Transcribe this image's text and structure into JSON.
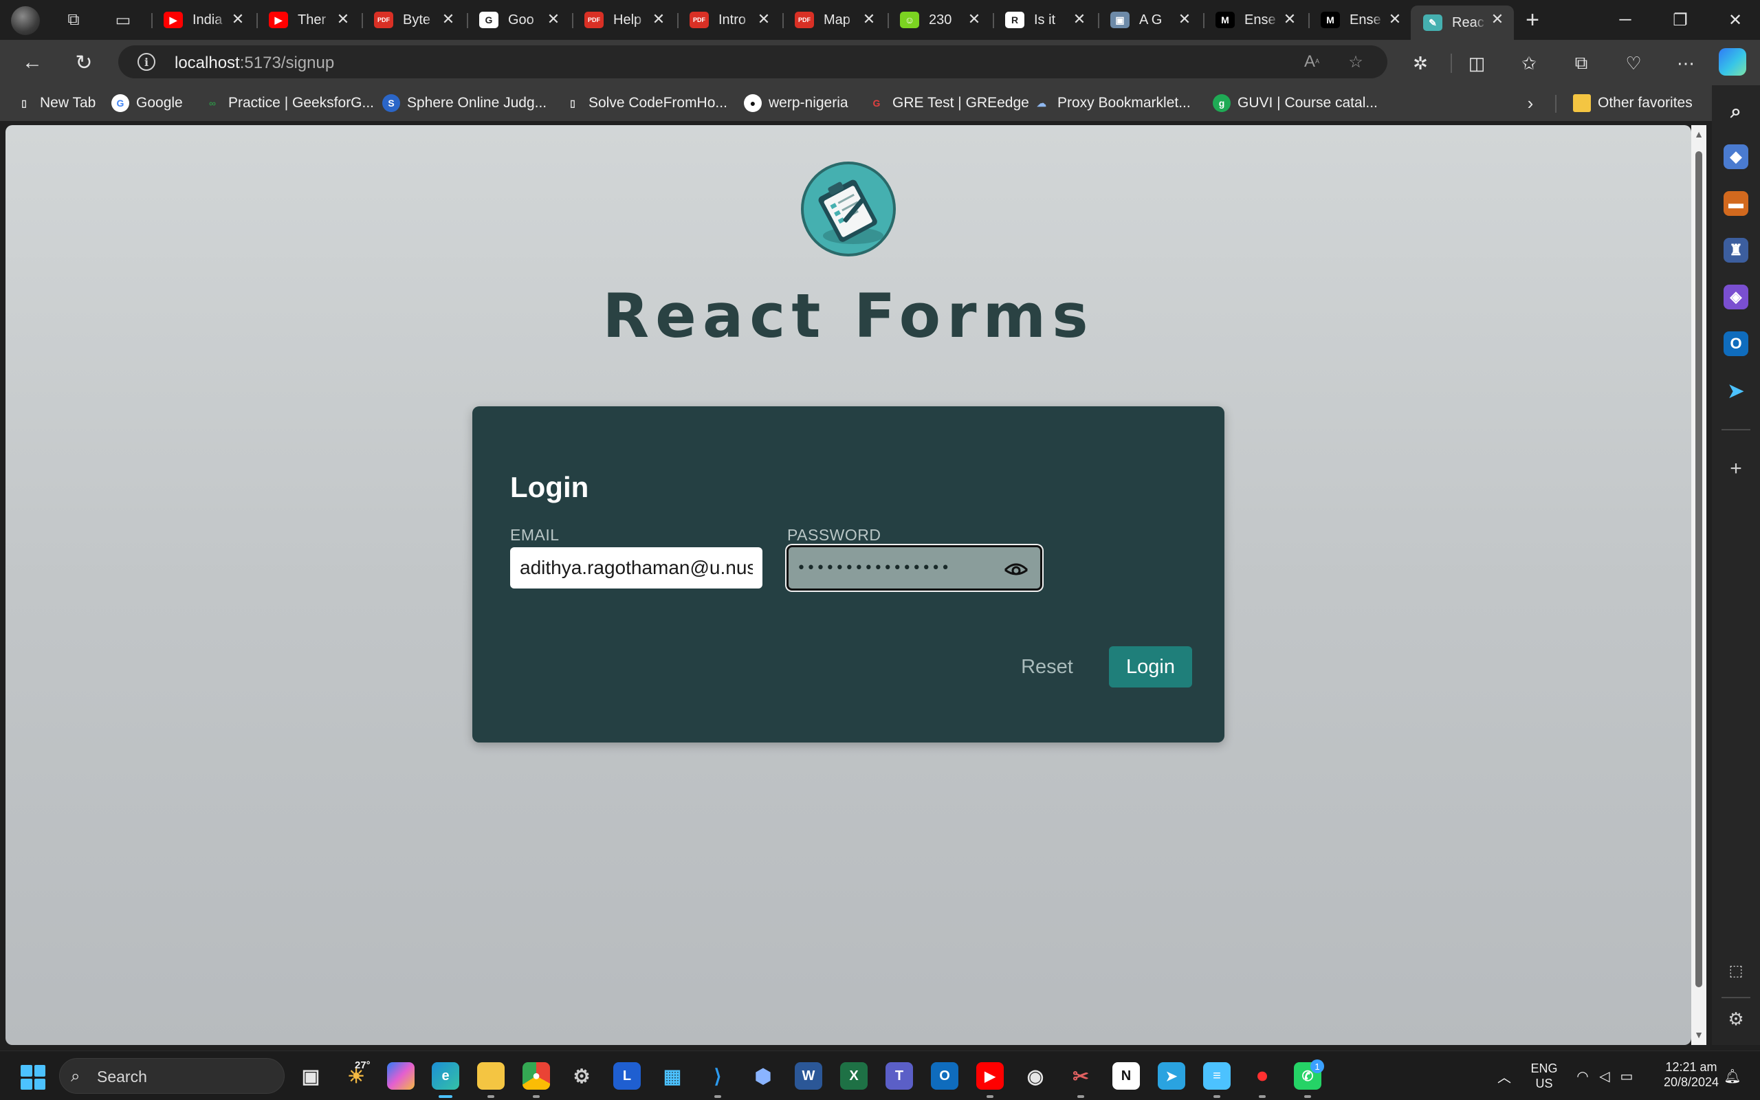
{
  "browser": {
    "tabs": [
      {
        "title": "India",
        "icon": "youtube-icon",
        "color": "#ff0000",
        "glyph": "▶"
      },
      {
        "title": "Ther",
        "icon": "youtube-icon",
        "color": "#ff0000",
        "glyph": "▶"
      },
      {
        "title": "Byte",
        "icon": "pdf-icon",
        "color": "#d93025",
        "glyph": "PDF"
      },
      {
        "title": "Goo",
        "icon": "google-icon",
        "color": "#ffffff",
        "glyph": "G"
      },
      {
        "title": "Help",
        "icon": "pdf-icon",
        "color": "#d93025",
        "glyph": "PDF"
      },
      {
        "title": "Intro",
        "icon": "pdf-icon",
        "color": "#d93025",
        "glyph": "PDF"
      },
      {
        "title": "Map",
        "icon": "pdf-icon",
        "color": "#d93025",
        "glyph": "PDF"
      },
      {
        "title": "230",
        "icon": "smiley-icon",
        "color": "#7bd321",
        "glyph": "☺"
      },
      {
        "title": "Is it",
        "icon": "researchgate-icon",
        "color": "#ffffff",
        "glyph": "R"
      },
      {
        "title": "A G",
        "icon": "document-image-icon",
        "color": "#6d8aa8",
        "glyph": "▣"
      },
      {
        "title": "Ense",
        "icon": "medium-icon",
        "color": "#000000",
        "glyph": "M"
      },
      {
        "title": "Ense",
        "icon": "medium-icon",
        "color": "#000000",
        "glyph": "M"
      },
      {
        "title": "Reac",
        "icon": "react-forms-icon",
        "color": "#45b0b0",
        "glyph": "✎",
        "active": true
      }
    ],
    "url_host": "localhost",
    "url_path": ":5173/signup",
    "favorites": [
      {
        "label": "New Tab",
        "icon": "page-icon"
      },
      {
        "label": "Google",
        "icon": "google-icon"
      },
      {
        "label": "Practice | GeeksforG...",
        "icon": "geeksforgeeks-icon"
      },
      {
        "label": "Sphere Online Judg...",
        "icon": "spoj-icon"
      },
      {
        "label": "Solve CodeFromHo...",
        "icon": "page-icon"
      },
      {
        "label": "werp-nigeria",
        "icon": "github-icon"
      },
      {
        "label": "GRE Test | GREedge",
        "icon": "greedge-icon"
      },
      {
        "label": "Proxy Bookmarklet...",
        "icon": "cloud-icon"
      },
      {
        "label": "GUVI | Course catal...",
        "icon": "guvi-icon"
      }
    ],
    "other_favorites": "Other favorites"
  },
  "page": {
    "title": "React Forms",
    "form": {
      "heading": "Login",
      "email_label": "EMAIL",
      "email_value": "adithya.ragothaman@u.nus",
      "password_label": "PASSWORD",
      "password_value": "••••••••••••••••",
      "reset_label": "Reset",
      "login_label": "Login"
    }
  },
  "taskbar": {
    "search_placeholder": "Search",
    "weather": "27°",
    "whatsapp_badge": "1",
    "lang_line1": "ENG",
    "lang_line2": "US",
    "time": "12:21 am",
    "date": "20/8/2024"
  }
}
